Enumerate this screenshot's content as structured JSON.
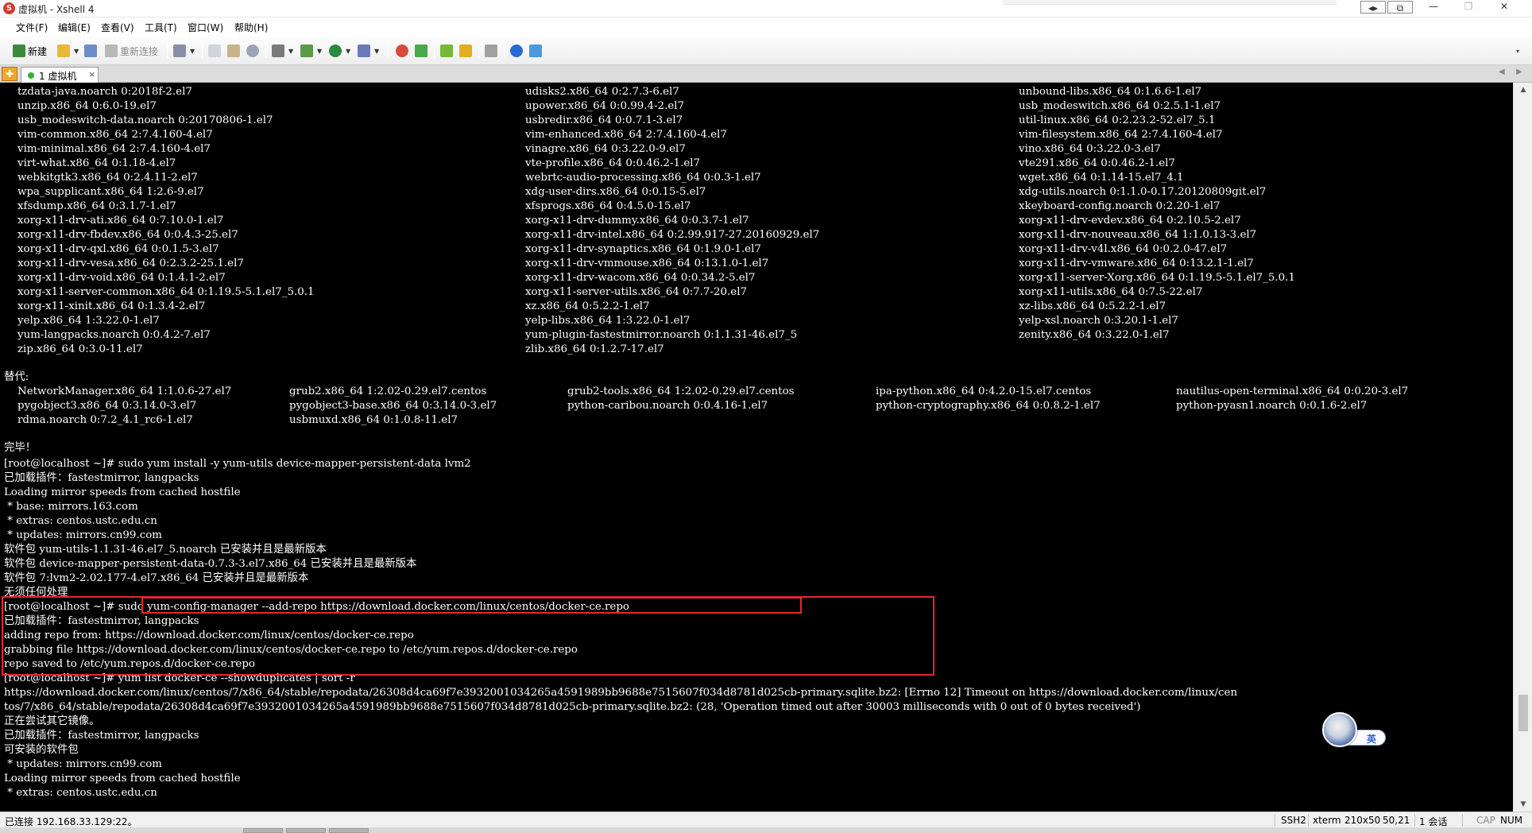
{
  "window": {
    "title": "虚拟机 - Xshell 4",
    "controls": [
      "◂▸",
      "⧉",
      "—",
      "❐",
      "✕"
    ]
  },
  "menu": [
    "文件(F)",
    "编辑(E)",
    "查看(V)",
    "工具(T)",
    "窗口(W)",
    "帮助(H)"
  ],
  "toolbar": {
    "new_label": "新建",
    "reconnect_label": "重新连接"
  },
  "tab": {
    "label": "1 虚拟机",
    "close": "×",
    "add": "✚"
  },
  "terminal": {
    "column_rows": [
      [
        "tzdata-java.noarch 0:2018f-2.el7",
        "udisks2.x86_64 0:2.7.3-6.el7",
        "unbound-libs.x86_64 0:1.6.6-1.el7"
      ],
      [
        "unzip.x86_64 0:6.0-19.el7",
        "upower.x86_64 0:0.99.4-2.el7",
        "usb_modeswitch.x86_64 0:2.5.1-1.el7"
      ],
      [
        "usb_modeswitch-data.noarch 0:20170806-1.el7",
        "usbredir.x86_64 0:0.7.1-3.el7",
        "util-linux.x86_64 0:2.23.2-52.el7_5.1"
      ],
      [
        "vim-common.x86_64 2:7.4.160-4.el7",
        "vim-enhanced.x86_64 2:7.4.160-4.el7",
        "vim-filesystem.x86_64 2:7.4.160-4.el7"
      ],
      [
        "vim-minimal.x86_64 2:7.4.160-4.el7",
        "vinagre.x86_64 0:3.22.0-9.el7",
        "vino.x86_64 0:3.22.0-3.el7"
      ],
      [
        "virt-what.x86_64 0:1.18-4.el7",
        "vte-profile.x86_64 0:0.46.2-1.el7",
        "vte291.x86_64 0:0.46.2-1.el7"
      ],
      [
        "webkitgtk3.x86_64 0:2.4.11-2.el7",
        "webrtc-audio-processing.x86_64 0:0.3-1.el7",
        "wget.x86_64 0:1.14-15.el7_4.1"
      ],
      [
        "wpa_supplicant.x86_64 1:2.6-9.el7",
        "xdg-user-dirs.x86_64 0:0.15-5.el7",
        "xdg-utils.noarch 0:1.1.0-0.17.20120809git.el7"
      ],
      [
        "xfsdump.x86_64 0:3.1.7-1.el7",
        "xfsprogs.x86_64 0:4.5.0-15.el7",
        "xkeyboard-config.noarch 0:2.20-1.el7"
      ],
      [
        "xorg-x11-drv-ati.x86_64 0:7.10.0-1.el7",
        "xorg-x11-drv-dummy.x86_64 0:0.3.7-1.el7",
        "xorg-x11-drv-evdev.x86_64 0:2.10.5-2.el7"
      ],
      [
        "xorg-x11-drv-fbdev.x86_64 0:0.4.3-25.el7",
        "xorg-x11-drv-intel.x86_64 0:2.99.917-27.20160929.el7",
        "xorg-x11-drv-nouveau.x86_64 1:1.0.13-3.el7"
      ],
      [
        "xorg-x11-drv-qxl.x86_64 0:0.1.5-3.el7",
        "xorg-x11-drv-synaptics.x86_64 0:1.9.0-1.el7",
        "xorg-x11-drv-v4l.x86_64 0:0.2.0-47.el7"
      ],
      [
        "xorg-x11-drv-vesa.x86_64 0:2.3.2-25.1.el7",
        "xorg-x11-drv-vmmouse.x86_64 0:13.1.0-1.el7",
        "xorg-x11-drv-vmware.x86_64 0:13.2.1-1.el7"
      ],
      [
        "xorg-x11-drv-void.x86_64 0:1.4.1-2.el7",
        "xorg-x11-drv-wacom.x86_64 0:0.34.2-5.el7",
        "xorg-x11-server-Xorg.x86_64 0:1.19.5-5.1.el7_5.0.1"
      ],
      [
        "xorg-x11-server-common.x86_64 0:1.19.5-5.1.el7_5.0.1",
        "xorg-x11-server-utils.x86_64 0:7.7-20.el7",
        "xorg-x11-utils.x86_64 0:7.5-22.el7"
      ],
      [
        "xorg-x11-xinit.x86_64 0:1.3.4-2.el7",
        "xz.x86_64 0:5.2.2-1.el7",
        "xz-libs.x86_64 0:5.2.2-1.el7"
      ],
      [
        "yelp.x86_64 1:3.22.0-1.el7",
        "yelp-libs.x86_64 1:3.22.0-1.el7",
        "yelp-xsl.noarch 0:3.20.1-1.el7"
      ],
      [
        "yum-langpacks.noarch 0:0.4.2-7.el7",
        "yum-plugin-fastestmirror.noarch 0:1.1.31-46.el7_5",
        "zenity.x86_64 0:3.22.0-1.el7"
      ],
      [
        "zip.x86_64 0:3.0-11.el7",
        "zlib.x86_64 0:1.2.7-17.el7",
        ""
      ]
    ],
    "replaced_header": "替代:",
    "replaced_rows": [
      [
        "NetworkManager.x86_64 1:1.0.6-27.el7",
        "grub2.x86_64 1:2.02-0.29.el7.centos",
        "grub2-tools.x86_64 1:2.02-0.29.el7.centos",
        "ipa-python.x86_64 0:4.2.0-15.el7.centos",
        "nautilus-open-terminal.x86_64 0:0.20-3.el7"
      ],
      [
        "pygobject3.x86_64 0:3.14.0-3.el7",
        "pygobject3-base.x86_64 0:3.14.0-3.el7",
        "python-caribou.noarch 0:0.4.16-1.el7",
        "python-cryptography.x86_64 0:0.8.2-1.el7",
        "python-pyasn1.noarch 0:0.1.6-2.el7"
      ],
      [
        "rdma.noarch 0:7.2_4.1_rc6-1.el7",
        "usbmuxd.x86_64 0:1.0.8-11.el7",
        "",
        "",
        ""
      ]
    ],
    "lines_after": [
      "完毕！",
      "[root@localhost ~]# sudo yum install -y yum-utils device-mapper-persistent-data lvm2",
      "已加载插件：fastestmirror, langpacks",
      "Loading mirror speeds from cached hostfile",
      " * base: mirrors.163.com",
      " * extras: centos.ustc.edu.cn",
      " * updates: mirrors.cn99.com",
      "软件包 yum-utils-1.1.31-46.el7_5.noarch 已安装并且是最新版本",
      "软件包 device-mapper-persistent-data-0.7.3-3.el7.x86_64 已安装并且是最新版本",
      "软件包 7:lvm2-2.02.177-4.el7.x86_64 已安装并且是最新版本",
      "无须任何处理",
      "[root@localhost ~]# sudo yum-config-manager --add-repo https://download.docker.com/linux/centos/docker-ce.repo",
      "已加载插件：fastestmirror, langpacks",
      "adding repo from: https://download.docker.com/linux/centos/docker-ce.repo",
      "grabbing file https://download.docker.com/linux/centos/docker-ce.repo to /etc/yum.repos.d/docker-ce.repo",
      "repo saved to /etc/yum.repos.d/docker-ce.repo",
      "[root@localhost ~]# yum list docker-ce --showduplicates | sort -r",
      "https://download.docker.com/linux/centos/7/x86_64/stable/repodata/26308d4ca69f7e3932001034265a4591989bb9688e7515607f034d8781d025cb-primary.sqlite.bz2: [Errno 12] Timeout on https://download.docker.com/linux/cen",
      "tos/7/x86_64/stable/repodata/26308d4ca69f7e3932001034265a4591989bb9688e7515607f034d8781d025cb-primary.sqlite.bz2: (28, 'Operation timed out after 30003 milliseconds with 0 out of 0 bytes received')",
      "正在尝试其它镜像。",
      "已加载插件：fastestmirror, langpacks",
      "可安装的软件包",
      " * updates: mirrors.cn99.com",
      "Loading mirror speeds from cached hostfile",
      " * extras: centos.ustc.edu.cn"
    ]
  },
  "ime": {
    "lang": "英"
  },
  "status": {
    "connection": "已连接 192.168.33.129:22。",
    "protocol": "SSH2",
    "term": "xterm",
    "size": "210x50",
    "cursor": "50,21",
    "sessions": "1 会话",
    "cap": "CAP",
    "num": "NUM"
  }
}
